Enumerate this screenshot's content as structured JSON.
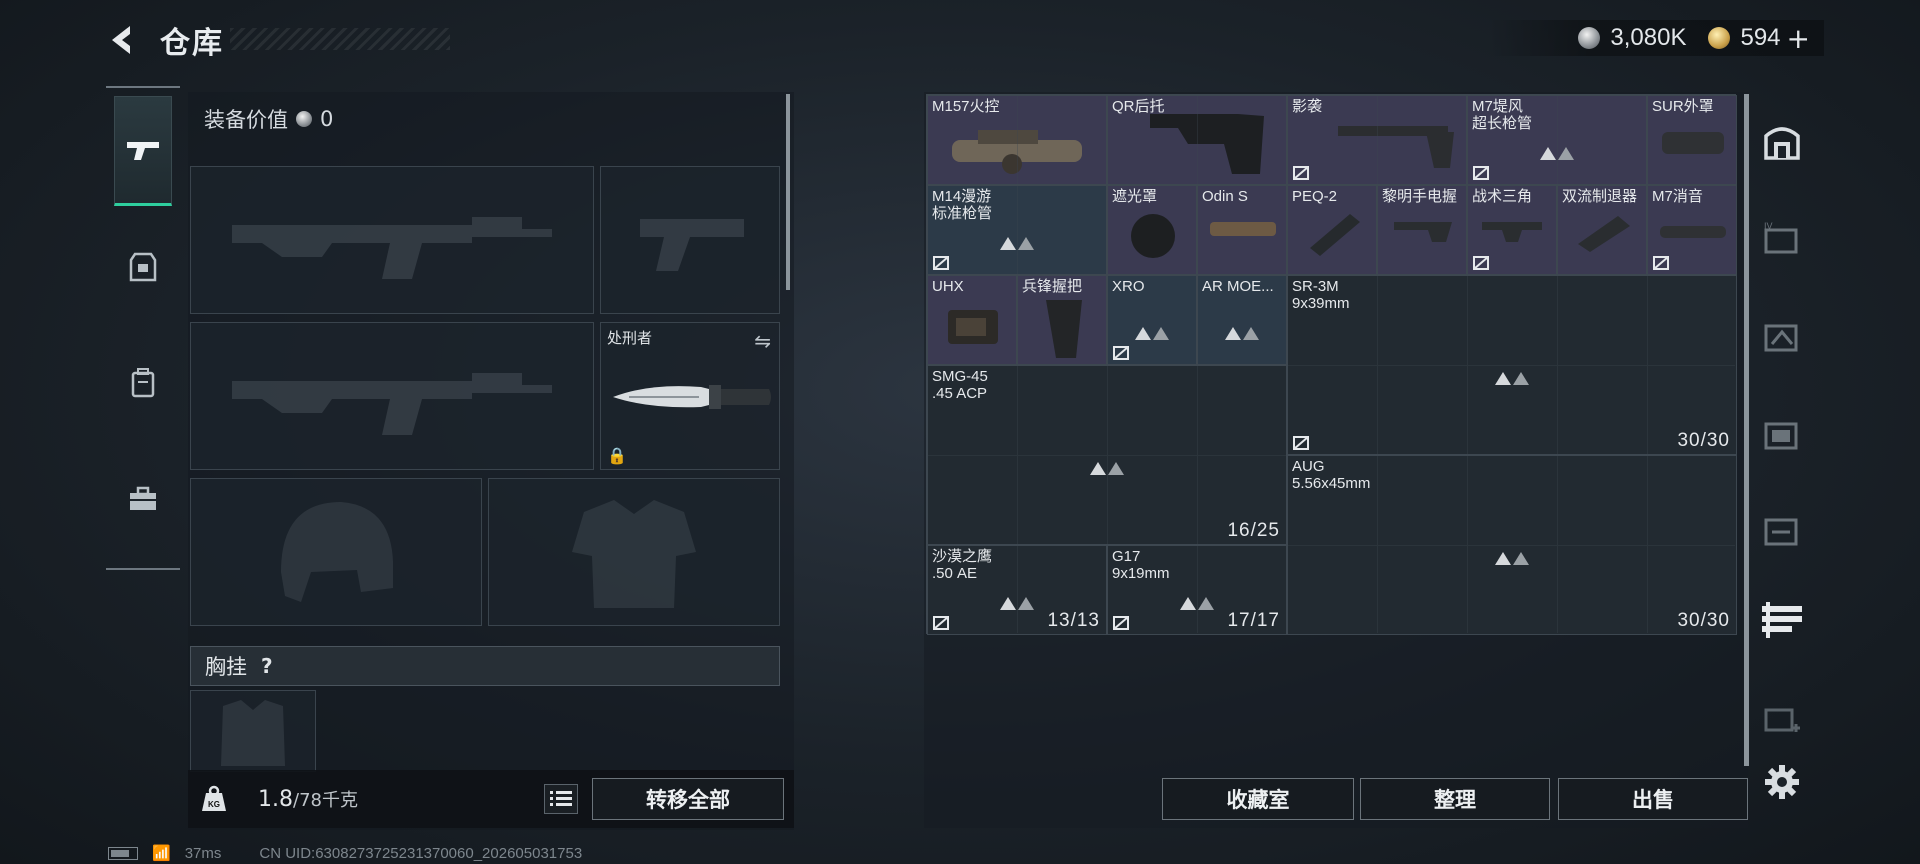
{
  "header": {
    "title": "仓库"
  },
  "currency": {
    "silver": "3,080K",
    "gold": "594",
    "plus": "+"
  },
  "equipment": {
    "value_label": "装备价值",
    "value": "0",
    "melee_name": "处刑者",
    "chest_label": "胸挂",
    "chest_help": "?",
    "weight_current": "1.8",
    "weight_max": "/78千克",
    "transfer_all": "转移全部"
  },
  "grid_items": [
    {
      "name": "M157火控",
      "rarity": "purple"
    },
    {
      "name": "QR后托",
      "rarity": "purple"
    },
    {
      "name": "影袭",
      "rarity": "purple"
    },
    {
      "name": "M7堤风\n超长枪管",
      "rarity": "purple"
    },
    {
      "name": "SUR外罩",
      "rarity": "purple"
    },
    {
      "name": "M14漫游\n标准枪管",
      "rarity": "blue"
    },
    {
      "name": "遮光罩",
      "rarity": "purple"
    },
    {
      "name": "Odin S",
      "rarity": "purple"
    },
    {
      "name": "PEQ-2",
      "rarity": "purple"
    },
    {
      "name": "黎明手电握",
      "rarity": "purple"
    },
    {
      "name": "战术三角",
      "rarity": "purple"
    },
    {
      "name": "双流制退器",
      "rarity": "purple"
    },
    {
      "name": "M7消音",
      "rarity": "purple"
    },
    {
      "name": "UHX",
      "rarity": "purple"
    },
    {
      "name": "兵锋握把",
      "rarity": "purple"
    },
    {
      "name": "XRO",
      "rarity": "blue"
    },
    {
      "name": "AR MOE...",
      "rarity": "blue"
    },
    {
      "name": "SR-3M\n9x39mm",
      "rarity": "dark"
    },
    {
      "name": "SMG-45\n.45 ACP",
      "rarity": "dark"
    },
    {
      "name": "AUG\n5.56x45mm",
      "rarity": "dark"
    },
    {
      "name": "沙漠之鹰\n.50 AE",
      "rarity": "dark"
    },
    {
      "name": "G17\n9x19mm",
      "rarity": "dark"
    }
  ],
  "counts": {
    "sr3m": "30/30",
    "smg45": "16/25",
    "aug": "30/30",
    "deagle": "13/13",
    "g17": "17/17"
  },
  "buttons": {
    "collection": "收藏室",
    "sort": "整理",
    "sell": "出售"
  },
  "status_bar": {
    "ping": "37ms",
    "uid": "CN UID:6308273725231370060_202605031753"
  },
  "colors": {
    "accent_green": "#2ecf9e",
    "purple_rarity": "#3b3a52",
    "blue_rarity": "#2c3a48"
  }
}
